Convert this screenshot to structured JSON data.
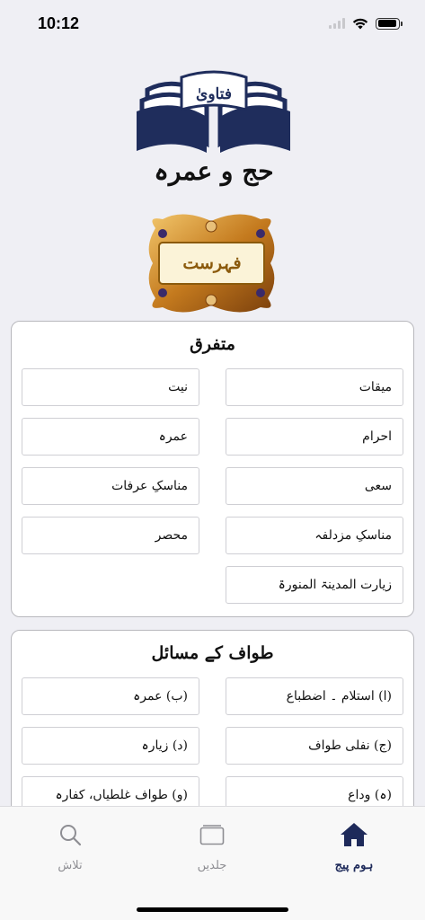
{
  "status_bar": {
    "time": "10:12",
    "battery_level": 0.92
  },
  "logo": {
    "top_text": "فتاویٰ",
    "bottom_text": "حج و عمرہ"
  },
  "index_button": {
    "label": "فہرست"
  },
  "sections": [
    {
      "title": "متفرق",
      "items": [
        "میقات",
        "نیت",
        "احرام",
        "عمرہ",
        "سعی",
        "مناسکِ عرفات",
        "مناسکِ مزدلفہ",
        "محصر",
        "زیارت المدینۃ المنورۃ"
      ]
    },
    {
      "title": "طواف کے مسائل",
      "items": [
        "(ا) استلام ۔ اضطباع",
        "(ب) عمرہ",
        "(ج) نفلی طواف",
        "(د) زیارہ",
        "(ہ) وداع",
        "(و) طواف غلطیاں، کفارہ"
      ]
    }
  ],
  "tab_bar": {
    "tabs": [
      {
        "label": "ہوم پیج",
        "icon": "home-icon",
        "active": true
      },
      {
        "label": "جلدیں",
        "icon": "book-icon",
        "active": false
      },
      {
        "label": "تلاش",
        "icon": "search-icon",
        "active": false
      }
    ]
  },
  "colors": {
    "accent": "#1e2a5a",
    "background": "#efeff4",
    "tab_inactive": "#8e8e93",
    "index_text": "#8b5a0c"
  }
}
